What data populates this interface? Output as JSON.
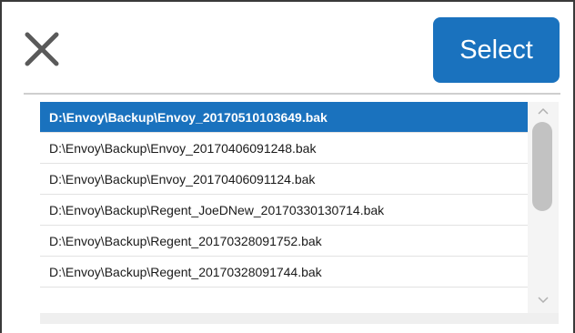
{
  "dialog": {
    "close_icon": "close-x-icon",
    "select_label": "Select",
    "accent_color": "#1a72be"
  },
  "file_list": {
    "selected_index": 0,
    "items": [
      "D:\\Envoy\\Backup\\Envoy_20170510103649.bak",
      "D:\\Envoy\\Backup\\Envoy_20170406091248.bak",
      "D:\\Envoy\\Backup\\Envoy_20170406091124.bak",
      "D:\\Envoy\\Backup\\Regent_JoeDNew_20170330130714.bak",
      "D:\\Envoy\\Backup\\Regent_20170328091752.bak",
      "D:\\Envoy\\Backup\\Regent_20170328091744.bak"
    ]
  },
  "scrollbar": {
    "up_icon": "chevron-up-icon",
    "down_icon": "chevron-down-icon"
  }
}
